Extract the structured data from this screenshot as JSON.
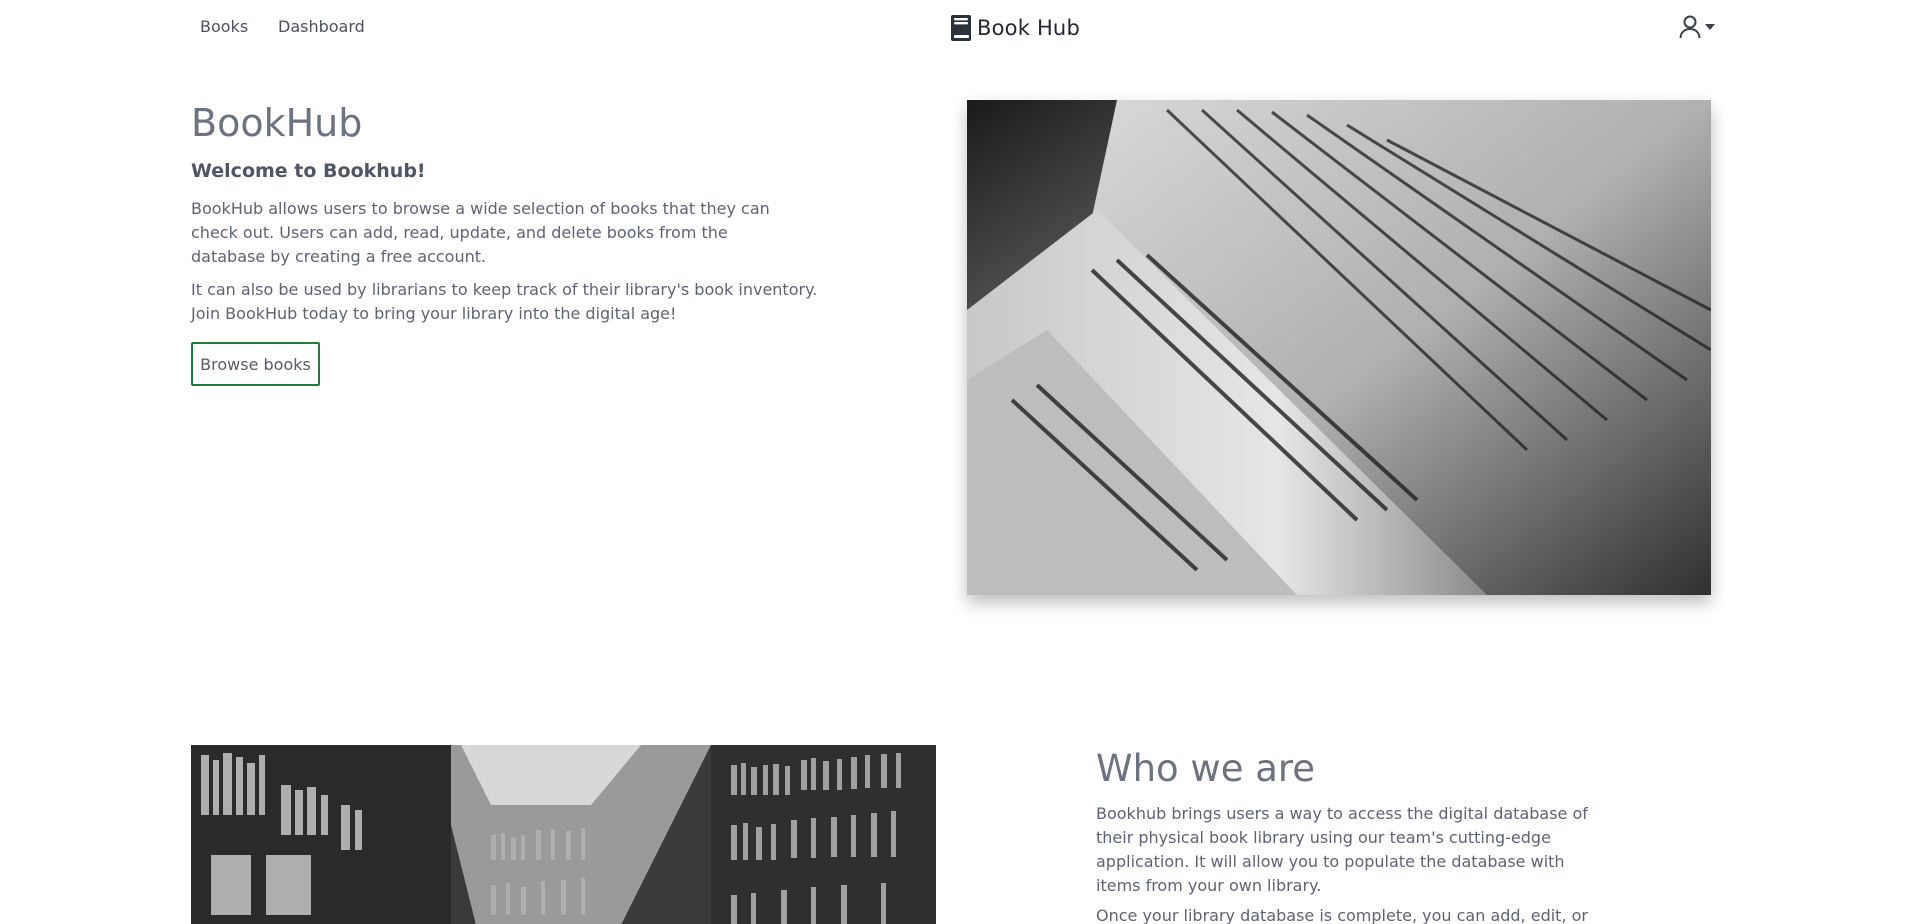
{
  "navbar": {
    "links": [
      {
        "label": "Books"
      },
      {
        "label": "Dashboard"
      }
    ],
    "brand": {
      "icon": "book-icon",
      "text": "Book Hub"
    },
    "user_menu": {
      "icon": "user-icon",
      "caret": "caret-down-icon"
    }
  },
  "hero": {
    "title": "BookHub",
    "subtitle": "Welcome to Bookhub!",
    "paragraph1": "BookHub allows users to browse a wide selection of books that they can check out. Users can add, read, update, and delete books from the database by creating a free account.",
    "paragraph2": "It can also be used by librarians to keep track of their library's book inventory. Join BookHub today to bring your library into the digital age!",
    "browse_button": "Browse books",
    "image": "open-book-photo"
  },
  "about": {
    "image": "library-shelves-photo",
    "title": "Who we are",
    "paragraph1": "Bookhub brings users a way to access the digital database of their physical book library using our team's cutting-edge application. It will allow you to populate the database with items from your own library.",
    "paragraph2": "Once your library database is complete, you can add, edit, or"
  },
  "colors": {
    "button_border": "#1e7d3a",
    "heading": "#6c7380",
    "text": "#5d6472"
  }
}
